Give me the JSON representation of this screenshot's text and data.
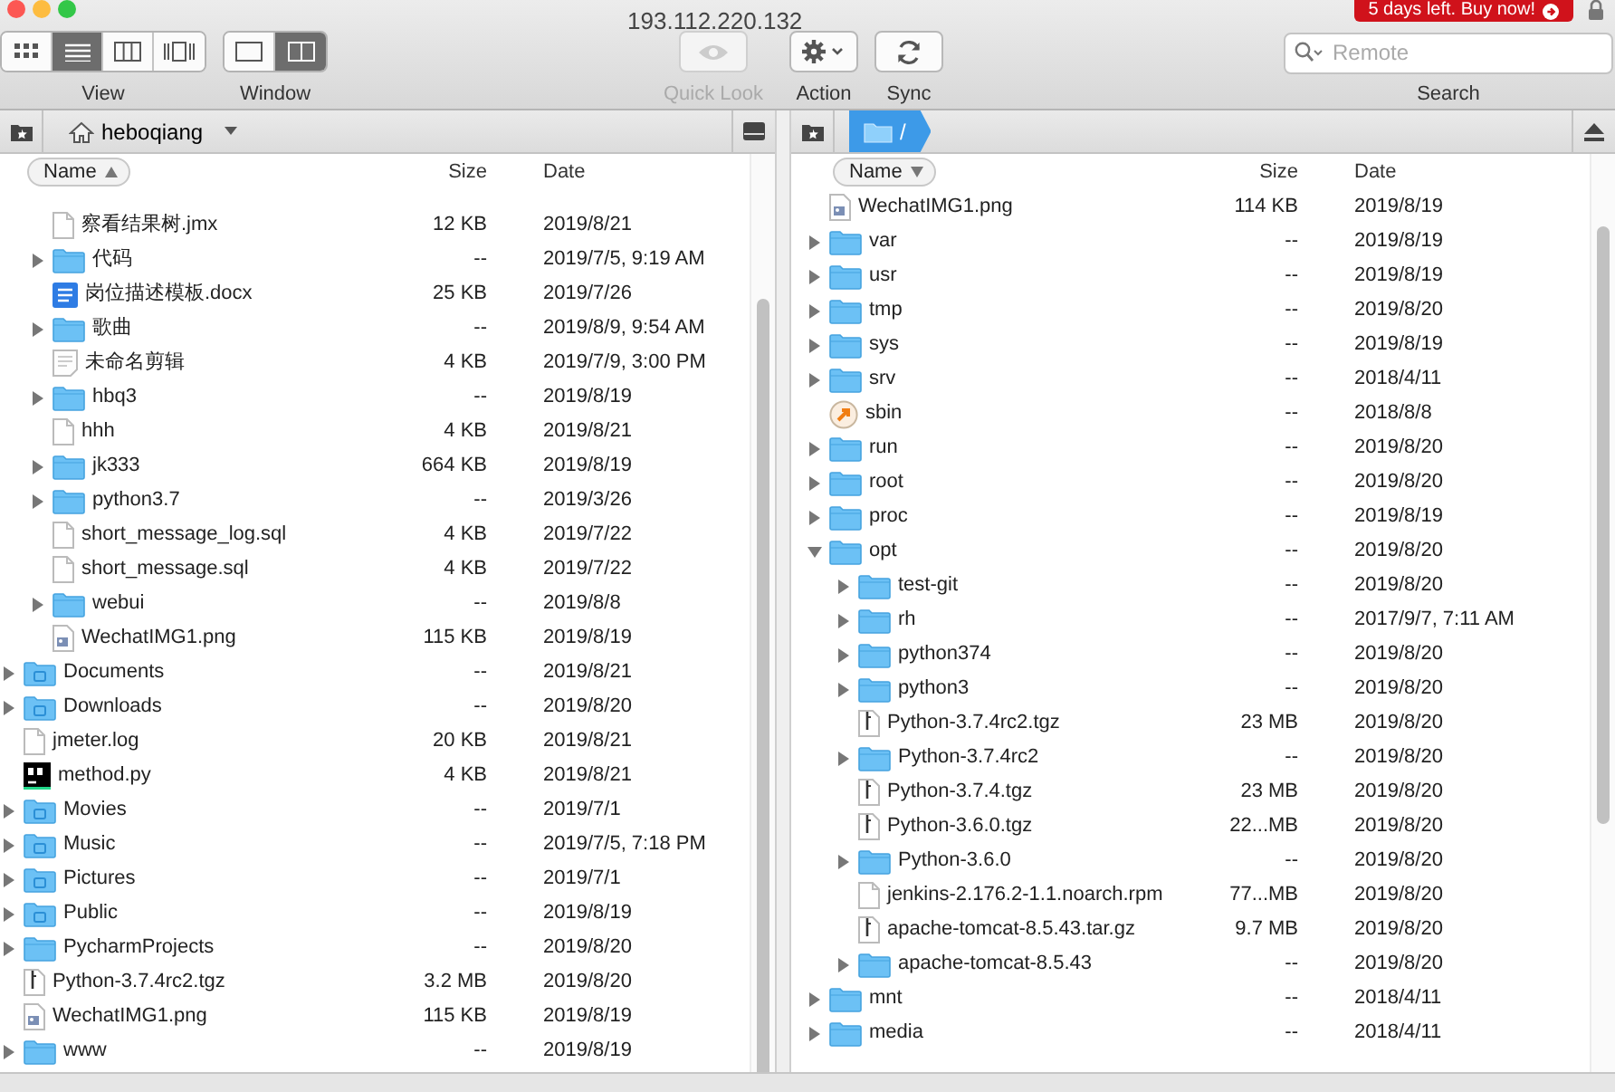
{
  "window": {
    "title": "193.112.220.132"
  },
  "trial_badge": {
    "text": "5 days left. Buy now!"
  },
  "toolbar": {
    "view": {
      "label": "View",
      "modes": [
        {
          "kind": "icons",
          "selected": false
        },
        {
          "kind": "list",
          "selected": true
        },
        {
          "kind": "columns",
          "selected": false
        },
        {
          "kind": "coverflow",
          "selected": false
        }
      ]
    },
    "window_mode": {
      "label": "Window",
      "modes": [
        {
          "kind": "single",
          "selected": false
        },
        {
          "kind": "dual",
          "selected": true
        }
      ]
    },
    "actions": [
      {
        "kind": "quicklook",
        "label": "Quick Look",
        "disabled": true
      },
      {
        "kind": "action",
        "label": "Action",
        "disabled": false
      },
      {
        "kind": "sync",
        "label": "Sync",
        "disabled": false
      }
    ],
    "search": {
      "placeholder": "Remote",
      "label": "Search"
    }
  },
  "left_pane": {
    "path": "heboqiang",
    "columns": [
      "Name",
      "Size",
      "Date"
    ],
    "sort_ascending": true,
    "rows": [
      {
        "children": [
          {
            "name": "察看结果树.jmx",
            "size": "12 KB",
            "date": "2019/8/21",
            "kind": "file"
          },
          {
            "name": "代码",
            "size": "--",
            "date": "2019/7/5, 9:19 AM",
            "kind": "folder",
            "expanded": false
          },
          {
            "name": "岗位描述模板.docx",
            "size": "25 KB",
            "date": "2019/7/26",
            "kind": "word"
          },
          {
            "name": "歌曲",
            "size": "--",
            "date": "2019/8/9, 9:54 AM",
            "kind": "folder",
            "expanded": false
          },
          {
            "name": "未命名剪辑",
            "size": "4 KB",
            "date": "2019/7/9, 3:00 PM",
            "kind": "clipping"
          },
          {
            "name": "hbq3",
            "size": "--",
            "date": "2019/8/19",
            "kind": "folder",
            "expanded": false
          },
          {
            "name": "hhh",
            "size": "4 KB",
            "date": "2019/8/21",
            "kind": "file"
          },
          {
            "name": "jk333",
            "size": "664 KB",
            "date": "2019/8/19",
            "kind": "folder",
            "expanded": false
          },
          {
            "name": "python3.7",
            "size": "--",
            "date": "2019/3/26",
            "kind": "folder",
            "expanded": false
          },
          {
            "name": "short_message_log.sql",
            "size": "4 KB",
            "date": "2019/7/22",
            "kind": "file"
          },
          {
            "name": "short_message.sql",
            "size": "4 KB",
            "date": "2019/7/22",
            "kind": "file"
          },
          {
            "name": "webui",
            "size": "--",
            "date": "2019/8/8",
            "kind": "folder",
            "expanded": false
          },
          {
            "name": "WechatIMG1.png",
            "size": "115 KB",
            "date": "2019/8/19",
            "kind": "image"
          }
        ]
      },
      {
        "name": "Documents",
        "size": "--",
        "date": "2019/8/21",
        "kind": "system-folder",
        "expanded": false
      },
      {
        "name": "Downloads",
        "size": "--",
        "date": "2019/8/20",
        "kind": "system-folder",
        "expanded": false
      },
      {
        "name": "jmeter.log",
        "size": "20 KB",
        "date": "2019/8/21",
        "kind": "file"
      },
      {
        "name": "method.py",
        "size": "4 KB",
        "date": "2019/8/21",
        "kind": "app"
      },
      {
        "name": "Movies",
        "size": "--",
        "date": "2019/7/1",
        "kind": "system-folder",
        "expanded": false
      },
      {
        "name": "Music",
        "size": "--",
        "date": "2019/7/5, 7:18 PM",
        "kind": "system-folder",
        "expanded": false
      },
      {
        "name": "Pictures",
        "size": "--",
        "date": "2019/7/1",
        "kind": "system-folder",
        "expanded": false
      },
      {
        "name": "Public",
        "size": "--",
        "date": "2019/8/19",
        "kind": "system-folder",
        "expanded": false
      },
      {
        "name": "PycharmProjects",
        "size": "--",
        "date": "2019/8/20",
        "kind": "folder",
        "expanded": false
      },
      {
        "name": "Python-3.7.4rc2.tgz",
        "size": "3.2 MB",
        "date": "2019/8/20",
        "kind": "archive"
      },
      {
        "name": "WechatIMG1.png",
        "size": "115 KB",
        "date": "2019/8/19",
        "kind": "image"
      },
      {
        "name": "www",
        "size": "--",
        "date": "2019/8/19",
        "kind": "folder",
        "expanded": false
      }
    ]
  },
  "right_pane": {
    "path": "/",
    "columns": [
      "Name",
      "Size",
      "Date"
    ],
    "sort_ascending": false,
    "rows": [
      {
        "name": "WechatIMG1.png",
        "size": "114 KB",
        "date": "2019/8/19",
        "kind": "image"
      },
      {
        "name": "var",
        "size": "--",
        "date": "2019/8/19",
        "kind": "folder",
        "expanded": false
      },
      {
        "name": "usr",
        "size": "--",
        "date": "2019/8/19",
        "kind": "folder",
        "expanded": false
      },
      {
        "name": "tmp",
        "size": "--",
        "date": "2019/8/20",
        "kind": "folder",
        "expanded": false
      },
      {
        "name": "sys",
        "size": "--",
        "date": "2019/8/19",
        "kind": "folder",
        "expanded": false
      },
      {
        "name": "srv",
        "size": "--",
        "date": "2018/4/11",
        "kind": "folder",
        "expanded": false
      },
      {
        "name": "sbin",
        "size": "--",
        "date": "2018/8/8",
        "kind": "alias"
      },
      {
        "name": "run",
        "size": "--",
        "date": "2019/8/20",
        "kind": "folder",
        "expanded": false
      },
      {
        "name": "root",
        "size": "--",
        "date": "2019/8/20",
        "kind": "folder",
        "expanded": false
      },
      {
        "name": "proc",
        "size": "--",
        "date": "2019/8/19",
        "kind": "folder",
        "expanded": false
      },
      {
        "name": "opt",
        "size": "--",
        "date": "2019/8/20",
        "kind": "folder",
        "expanded": true,
        "children": [
          {
            "name": "test-git",
            "size": "--",
            "date": "2019/8/20",
            "kind": "folder",
            "expanded": false
          },
          {
            "name": "rh",
            "size": "--",
            "date": "2017/9/7, 7:11 AM",
            "kind": "folder",
            "expanded": false
          },
          {
            "name": "python374",
            "size": "--",
            "date": "2019/8/20",
            "kind": "folder",
            "expanded": false
          },
          {
            "name": "python3",
            "size": "--",
            "date": "2019/8/20",
            "kind": "folder",
            "expanded": false
          },
          {
            "name": "Python-3.7.4rc2.tgz",
            "size": "23 MB",
            "date": "2019/8/20",
            "kind": "archive"
          },
          {
            "name": "Python-3.7.4rc2",
            "size": "--",
            "date": "2019/8/20",
            "kind": "folder",
            "expanded": false
          },
          {
            "name": "Python-3.7.4.tgz",
            "size": "23 MB",
            "date": "2019/8/20",
            "kind": "archive"
          },
          {
            "name": "Python-3.6.0.tgz",
            "size": "22...MB",
            "date": "2019/8/20",
            "kind": "archive"
          },
          {
            "name": "Python-3.6.0",
            "size": "--",
            "date": "2019/8/20",
            "kind": "folder",
            "expanded": false
          },
          {
            "name": "jenkins-2.176.2-1.1.noarch.rpm",
            "size": "77...MB",
            "date": "2019/8/20",
            "kind": "file"
          },
          {
            "name": "apache-tomcat-8.5.43.tar.gz",
            "size": "9.7 MB",
            "date": "2019/8/20",
            "kind": "archive"
          },
          {
            "name": "apache-tomcat-8.5.43",
            "size": "--",
            "date": "2019/8/20",
            "kind": "folder",
            "expanded": false
          }
        ]
      },
      {
        "name": "mnt",
        "size": "--",
        "date": "2018/4/11",
        "kind": "folder",
        "expanded": false
      },
      {
        "name": "media",
        "size": "--",
        "date": "2018/4/11",
        "kind": "folder",
        "expanded": false
      }
    ]
  }
}
